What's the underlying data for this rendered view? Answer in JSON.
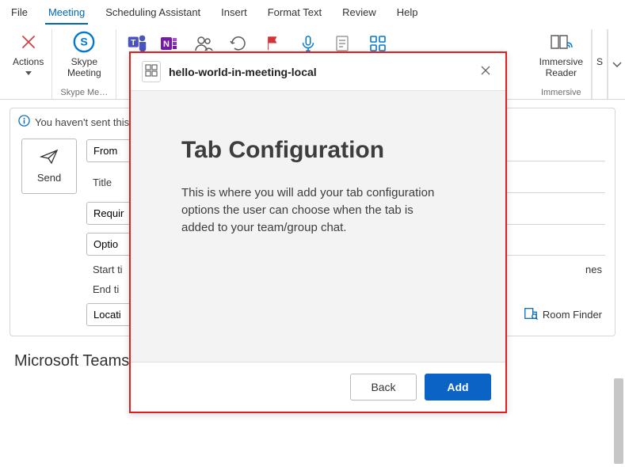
{
  "menubar": {
    "items": [
      "File",
      "Meeting",
      "Scheduling Assistant",
      "Insert",
      "Format Text",
      "Review",
      "Help"
    ],
    "active_index": 1
  },
  "ribbon": {
    "actions_label": "Actions",
    "skype_label": "Skype\nMeeting",
    "skype_group_label": "Skype Me…",
    "immersive_label": "Immersive\nReader",
    "immersive_group_label": "Immersive",
    "extra_label": "S"
  },
  "info_bar": {
    "text": "You haven't sent this"
  },
  "compose": {
    "send_label": "Send",
    "from_label": "From",
    "title_label": "Title",
    "required_label": "Requir",
    "optional_label": "Optio",
    "start_label": "Start ti",
    "end_label": "End ti",
    "location_label": "Locati",
    "time_zones_label": "nes",
    "room_finder_label": "Room Finder"
  },
  "body": {
    "heading": "Microsoft Teams meeting"
  },
  "modal": {
    "app_name": "hello-world-in-meeting-local",
    "heading": "Tab Configuration",
    "description": "This is where you will add your tab configuration options the user can choose when the tab is added to your team/group chat.",
    "back_label": "Back",
    "add_label": "Add"
  }
}
